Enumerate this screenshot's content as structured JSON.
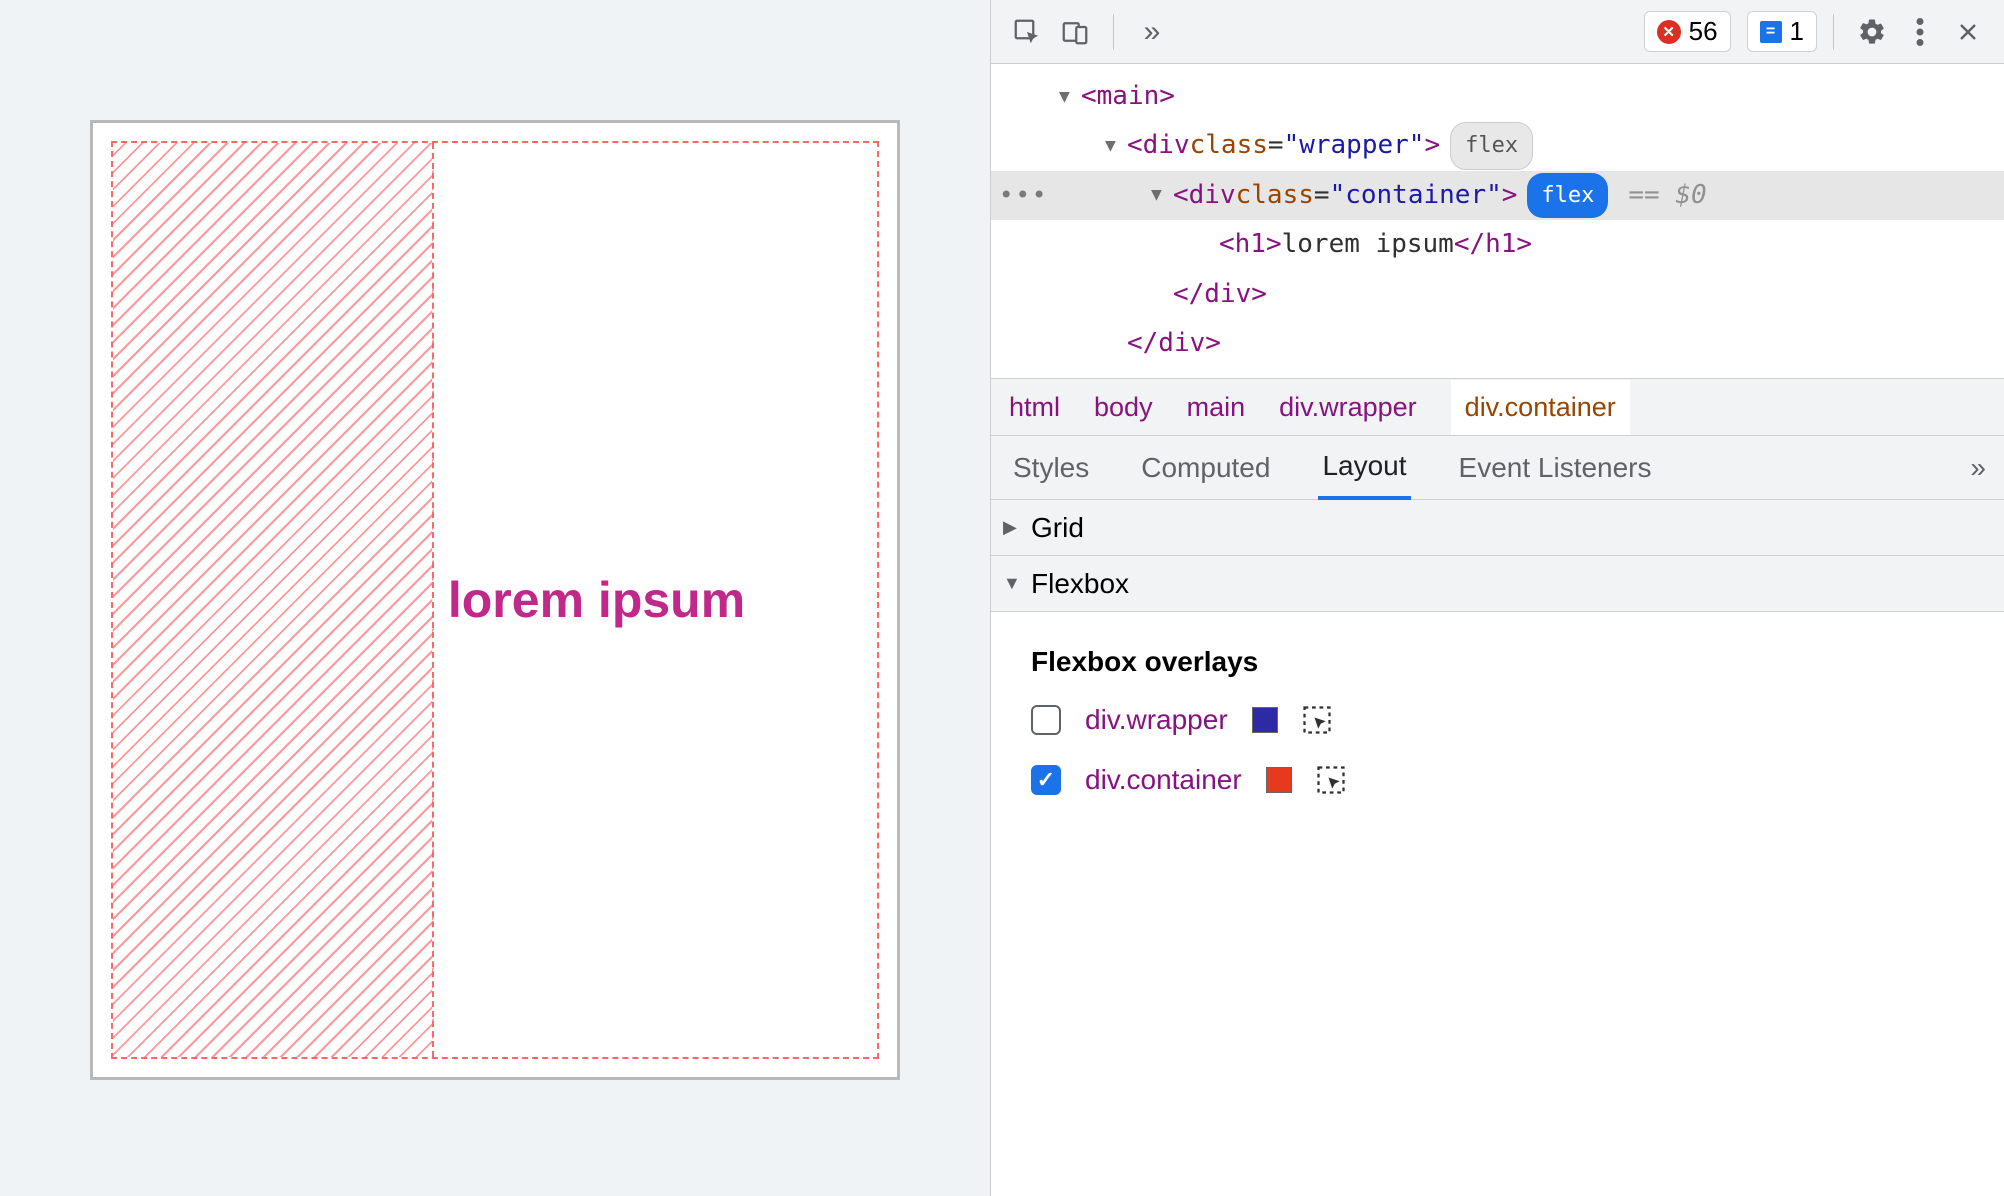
{
  "viewport": {
    "heading_text": "lorem ipsum"
  },
  "toolbar": {
    "errors_count": "56",
    "issues_count": "1"
  },
  "dom": {
    "main_open": "<main>",
    "wrapper_open_pre": "<div ",
    "wrapper_attr_name": "class",
    "wrapper_attr_val": "\"wrapper\"",
    "wrapper_open_post": ">",
    "wrapper_pill": "flex",
    "container_open_pre": "<div ",
    "container_attr_name": "class",
    "container_attr_val": "\"container\"",
    "container_open_post": ">",
    "container_pill": "flex",
    "container_eqvar": "== $0",
    "h1_open": "<h1>",
    "h1_text": "lorem ipsum",
    "h1_close": "</h1>",
    "div_close1": "</div>",
    "div_close2": "</div>"
  },
  "breadcrumb": {
    "b0": "html",
    "b1": "body",
    "b2": "main",
    "b3": "div.wrapper",
    "b4": "div.container"
  },
  "subtabs": {
    "t0": "Styles",
    "t1": "Computed",
    "t2": "Layout",
    "t3": "Event Listeners"
  },
  "sections": {
    "grid": "Grid",
    "flexbox": "Flexbox",
    "overlays_heading": "Flexbox overlays",
    "ov1_label": "div.wrapper",
    "ov1_color": "#2e2aa6",
    "ov2_label": "div.container",
    "ov2_color": "#e63a1e"
  }
}
